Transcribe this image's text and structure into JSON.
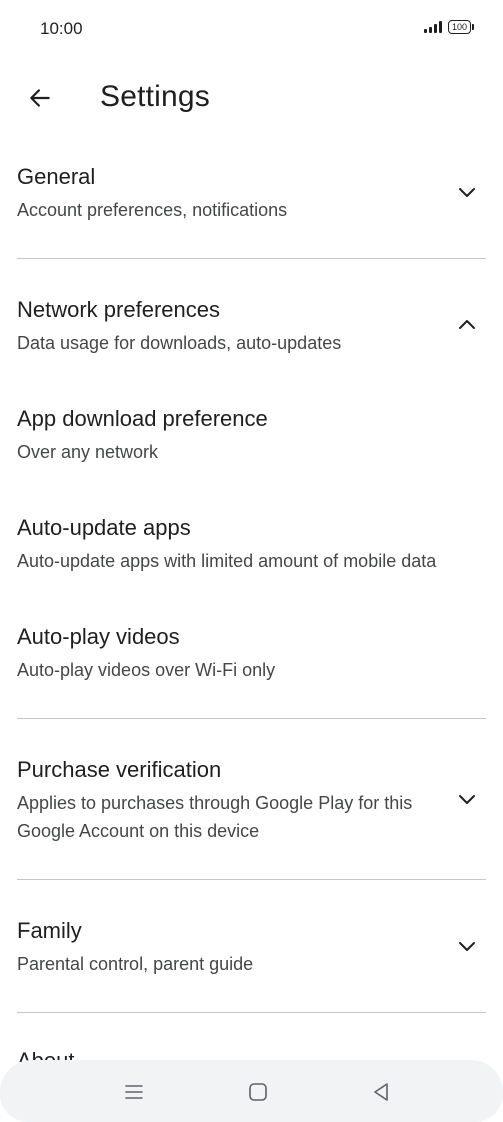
{
  "status_bar": {
    "time": "10:00",
    "battery": "100"
  },
  "header": {
    "title": "Settings"
  },
  "sections": {
    "general": {
      "title": "General",
      "subtitle": "Account preferences, notifications"
    },
    "network": {
      "title": "Network preferences",
      "subtitle": "Data usage for downloads, auto-updates"
    },
    "app_download": {
      "title": "App download preference",
      "subtitle": "Over any network"
    },
    "auto_update": {
      "title": "Auto-update apps",
      "subtitle": "Auto-update apps with limited amount of mobile data"
    },
    "auto_play": {
      "title": "Auto-play videos",
      "subtitle": "Auto-play videos over Wi-Fi only"
    },
    "purchase": {
      "title": "Purchase verification",
      "subtitle": "Applies to purchases through Google Play for this Google Account on this device"
    },
    "family": {
      "title": "Family",
      "subtitle": "Parental control, parent guide"
    },
    "about": {
      "title": "About"
    }
  },
  "icons": {
    "back": "arrow-left-icon",
    "expand": "chevron-down-icon",
    "collapse": "chevron-up-icon",
    "nav_menu": "menu-icon",
    "nav_home": "home-icon",
    "nav_back": "triangle-back-icon"
  },
  "colors": {
    "text_primary": "#1f1f1f",
    "text_secondary": "#444746",
    "divider": "#c4c7c5",
    "nav_bar": "#f1f3f4"
  }
}
